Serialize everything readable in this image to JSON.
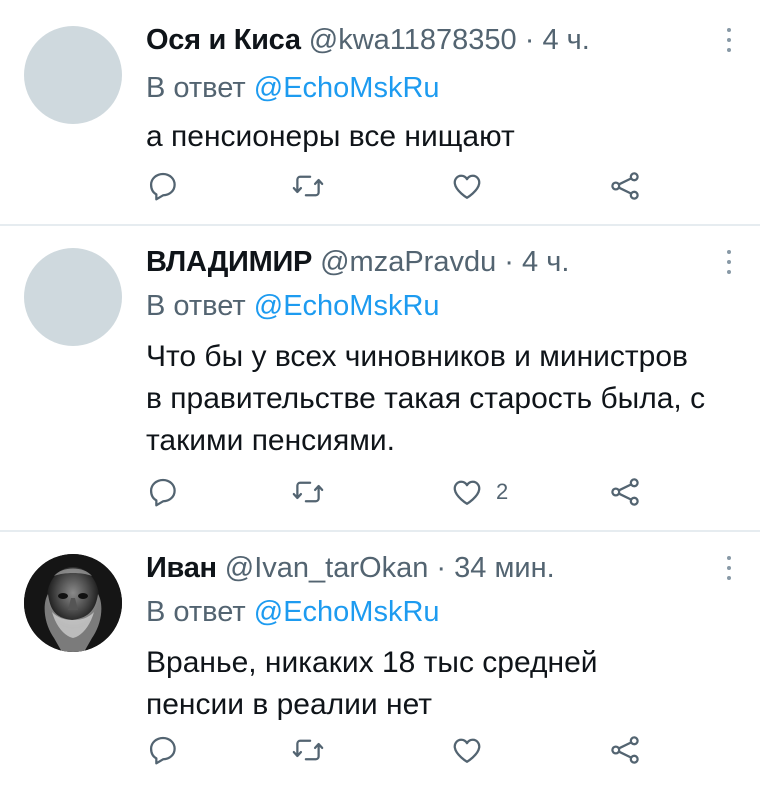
{
  "tweets": [
    {
      "name": "Ося и Киса",
      "handle": "@kwa11878350",
      "separator": "·",
      "time": "4 ч.",
      "reply_prefix": "В ответ",
      "reply_to": "@EchoMskRu",
      "text": "а пенсионеры все нищают",
      "likes": "",
      "avatar": "placeholder"
    },
    {
      "name": "ВЛАДИМИР",
      "handle": "@mzaPravdu",
      "separator": "·",
      "time": "4 ч.",
      "reply_prefix": "В ответ",
      "reply_to": "@EchoMskRu",
      "text": "Что бы у всех чиновников и министров в правительстве такая старость была, с такими пенсиями.",
      "likes": "2",
      "avatar": "placeholder"
    },
    {
      "name": "Иван",
      "handle": "@Ivan_tarOkan",
      "separator": "·",
      "time": "34 мин.",
      "reply_prefix": "В ответ",
      "reply_to": "@EchoMskRu",
      "text": "Вранье, никаких 18 тыс средней пенсии в реалии нет",
      "likes": "",
      "avatar": "photo"
    }
  ],
  "colors": {
    "text": "#0f1419",
    "secondary": "#536471",
    "mention": "#1d9bf0",
    "divider": "#e6ecf0",
    "avatar_placeholder": "#cfd9de"
  },
  "icons": [
    "reply-icon",
    "retweet-icon",
    "like-icon",
    "share-icon",
    "more-icon"
  ]
}
